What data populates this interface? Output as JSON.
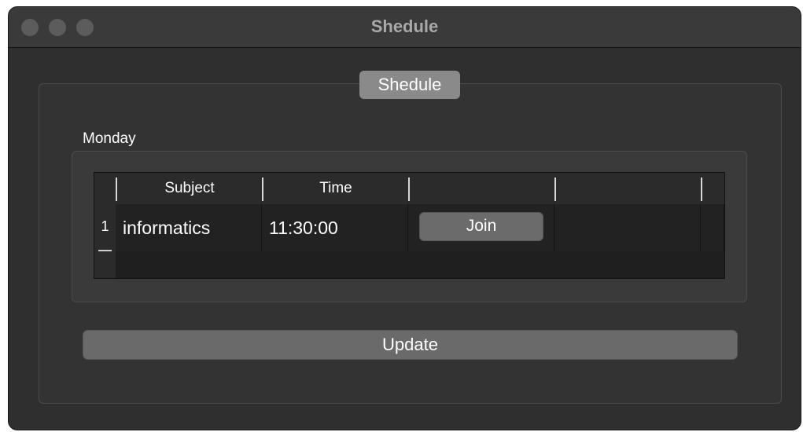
{
  "window": {
    "title": "Shedule"
  },
  "group": {
    "title": "Shedule",
    "day_label": "Monday"
  },
  "table": {
    "columns": [
      "Subject",
      "Time",
      "",
      ""
    ],
    "rows": [
      {
        "row_number": "1",
        "subject": "informatics",
        "time": "11:30:00",
        "action_label": "Join"
      }
    ]
  },
  "footer": {
    "update_label": "Update"
  },
  "colors": {
    "window_bg": "#2f2f2f",
    "button_bg": "#6a6a6a",
    "title_badge_bg": "#8a8a8a",
    "text": "#ffffff"
  },
  "icons": [
    "close-traffic-light",
    "minimize-traffic-light",
    "zoom-traffic-light"
  ]
}
